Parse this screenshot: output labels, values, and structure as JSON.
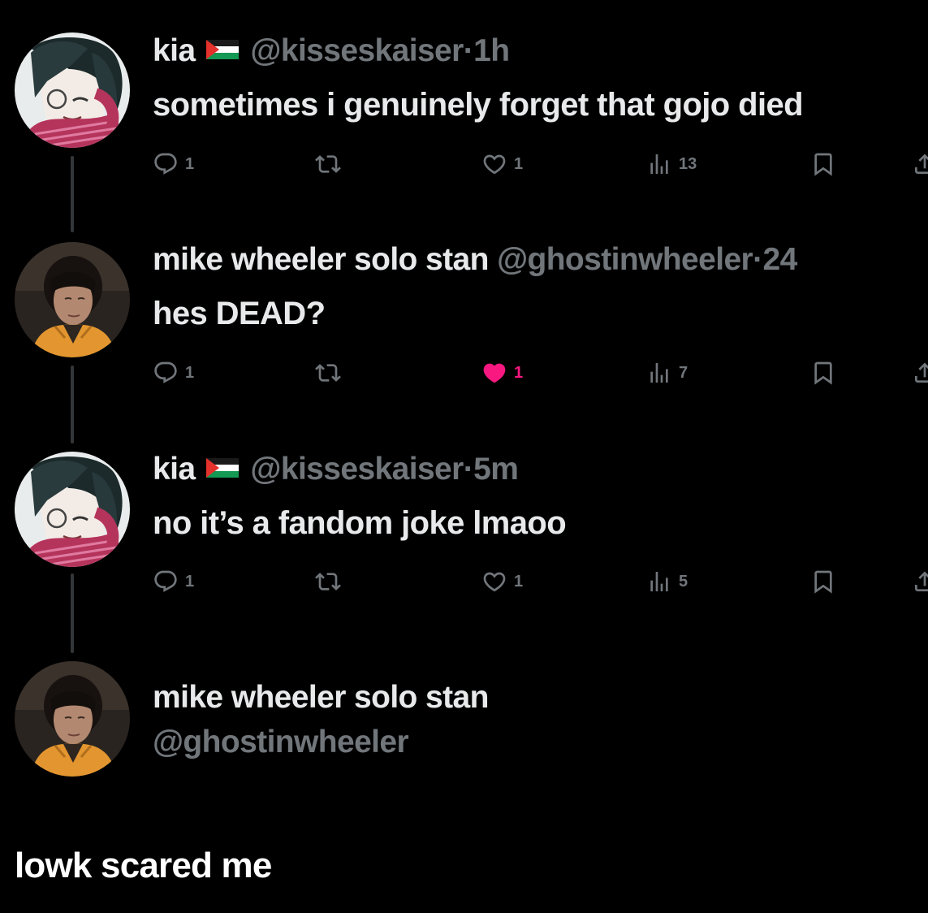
{
  "colors": {
    "background": "#000000",
    "primary_text": "#e7e9ea",
    "secondary_text": "#71767b",
    "like_active": "#f91880",
    "thread_line": "#333639"
  },
  "tweets": [
    {
      "name": "kia",
      "flag": "palestine-flag-icon",
      "handle": "@kisseskaiser",
      "separator": "·",
      "time": "1h",
      "text": "sometimes i genuinely forget that gojo died",
      "reply_count": "1",
      "like_count": "1",
      "liked": false,
      "view_count": "13",
      "avatar": "anime-character-avatar"
    },
    {
      "name": "mike wheeler solo stan",
      "handle": "@ghostinwheeler",
      "separator": "·",
      "time": "24",
      "text": "hes DEAD?",
      "reply_count": "1",
      "like_count": "1",
      "liked": true,
      "view_count": "7",
      "avatar": "person-photo-avatar"
    },
    {
      "name": "kia",
      "flag": "palestine-flag-icon",
      "handle": "@kisseskaiser",
      "separator": "·",
      "time": "5m",
      "text": "no it’s a fandom joke lmaoo",
      "reply_count": "1",
      "like_count": "1",
      "liked": false,
      "view_count": "5",
      "avatar": "anime-character-avatar"
    }
  ],
  "composer": {
    "name": "mike wheeler solo stan",
    "handle": "@ghostinwheeler",
    "avatar": "person-photo-avatar"
  },
  "caption": "lowk scared me"
}
